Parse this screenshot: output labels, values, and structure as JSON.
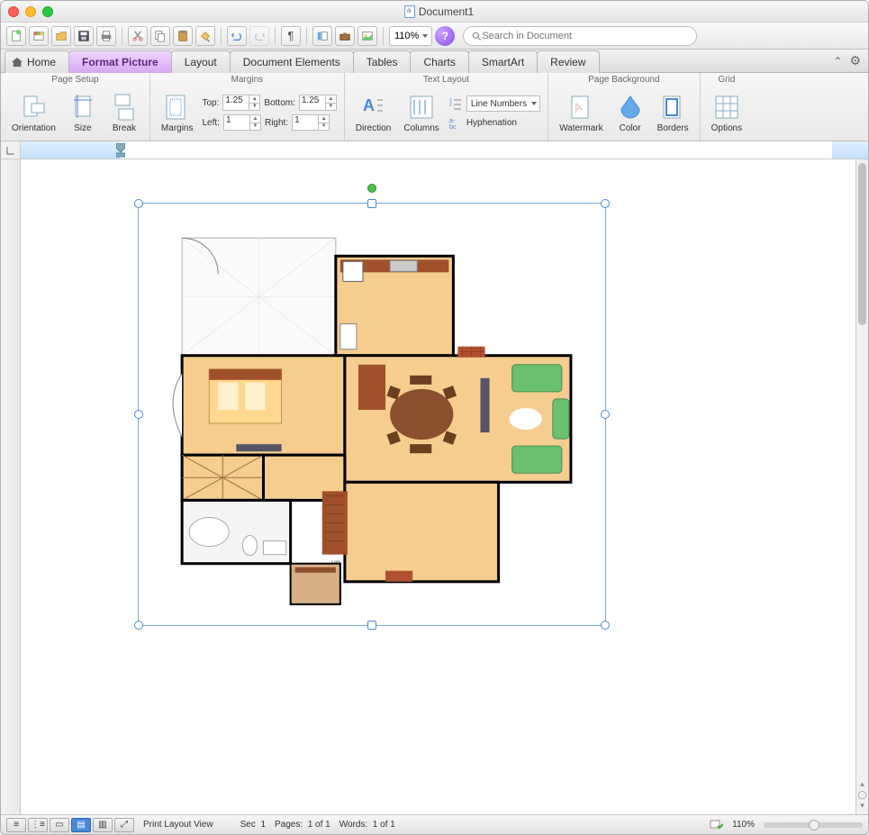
{
  "window": {
    "title": "Document1"
  },
  "toolbar": {
    "zoom": "110%"
  },
  "search": {
    "placeholder": "Search in Document"
  },
  "tabs": {
    "home": "Home",
    "format_picture": "Format Picture",
    "layout": "Layout",
    "document_elements": "Document Elements",
    "tables": "Tables",
    "charts": "Charts",
    "smartart": "SmartArt",
    "review": "Review"
  },
  "ribbon": {
    "page_setup": {
      "title": "Page Setup",
      "orientation": "Orientation",
      "size": "Size",
      "break": "Break"
    },
    "margins_group": {
      "title": "Margins",
      "margins_btn": "Margins",
      "top_label": "Top:",
      "top_val": "1.25",
      "bottom_label": "Bottom:",
      "bottom_val": "1.25",
      "left_label": "Left:",
      "left_val": "1",
      "right_label": "Right:",
      "right_val": "1"
    },
    "text_layout": {
      "title": "Text Layout",
      "direction": "Direction",
      "columns": "Columns",
      "line_numbers": "Line Numbers",
      "hyphenation": "Hyphenation"
    },
    "page_background": {
      "title": "Page Background",
      "watermark": "Watermark",
      "color": "Color",
      "borders": "Borders"
    },
    "grid": {
      "title": "Grid",
      "options": "Options"
    }
  },
  "status": {
    "view_name": "Print Layout View",
    "sec_label": "Sec",
    "sec_val": "1",
    "pages_label": "Pages:",
    "pages_val": "1 of 1",
    "words_label": "Words:",
    "words_val": "1 of 1",
    "zoom": "110%"
  },
  "floorplan": {
    "label_up": "up"
  }
}
